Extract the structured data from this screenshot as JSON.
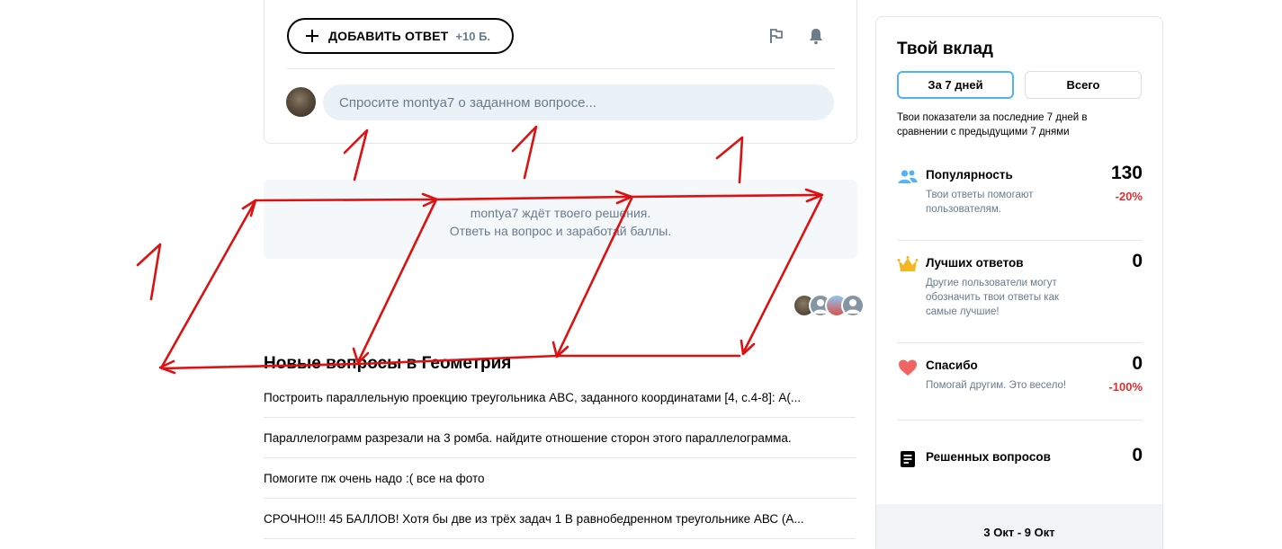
{
  "answer_card": {
    "add_answer_label": "ДОБАВИТЬ ОТВЕТ",
    "add_answer_points": "+10 Б.",
    "ask_placeholder": "Спросите montya7 о заданном вопросе..."
  },
  "waiting": {
    "line1": "montya7 ждёт твоего решения.",
    "line2": "Ответь на вопрос и заработай баллы."
  },
  "new_questions": {
    "title": "Новые вопросы в Геометрия",
    "items": [
      "Построить параллельную проекцию треугольника ABC, заданного координатами [4, с.4-8]: A(...",
      "Параллелограмм разрезали на 3 ромба. найдите отношение сторон этого параллелограмма.",
      "Помогите пж очень надо :( все на фото",
      "СРОЧНО!!! 45 БАЛЛОВ! Хотя бы две из трёх задач 1 В равнобедренном треугольнике АВС (А..."
    ]
  },
  "contribution": {
    "title": "Твой вклад",
    "tabs": [
      "За 7 дней",
      "Всего"
    ],
    "active_tab": "За 7 дней",
    "description": "Твои показатели за последние 7 дней в сравнении с предыдущими 7 днями",
    "stats": [
      {
        "icon": "users-icon",
        "label": "Популярность",
        "desc": "Твои ответы помогают пользователям.",
        "value": "130",
        "delta": "-20%"
      },
      {
        "icon": "crown-icon",
        "label": "Лучших ответов",
        "desc": "Другие пользователи могут обозначить твои ответы как самые лучшие!",
        "value": "0",
        "delta": ""
      },
      {
        "icon": "heart-icon",
        "label": "Спасибо",
        "desc": "Помогай другим. Это весело!",
        "value": "0",
        "delta": "-100%"
      },
      {
        "icon": "document-icon",
        "label": "Решенных вопросов",
        "desc": "",
        "value": "0",
        "delta": ""
      }
    ],
    "date_range": "3 Окт - 9 Окт"
  },
  "colors": {
    "accent_blue": "#4fb3f6",
    "negative_red": "#e22d31",
    "muted_gray": "#687b8c",
    "drawing_red": "#dd1111"
  }
}
